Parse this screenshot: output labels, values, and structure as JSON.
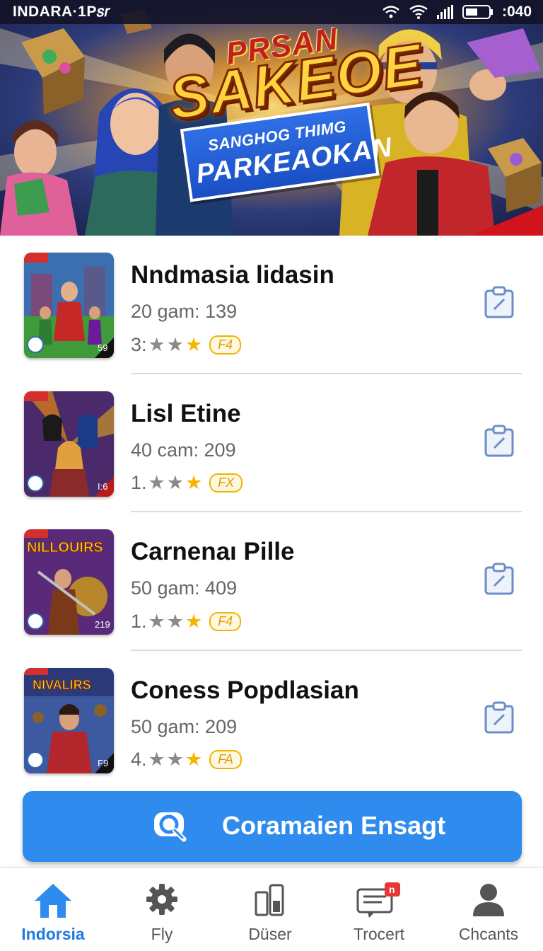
{
  "status_bar": {
    "carrier": "INDARA·1Ρ𝑠𝑟",
    "time": ":040"
  },
  "banner": {
    "title_top": "PRSAN",
    "title_main": "SAKEOE",
    "ribbon_line1": "SANGHOG THIMG",
    "ribbon_line2": "PARKEAOKAN"
  },
  "games": [
    {
      "title": "Nndmasia lidasin",
      "meta": "20 gam: 139",
      "rating_prefix": "3:",
      "tag": "F4",
      "thumb_badge": "59"
    },
    {
      "title": "Lisl Etine",
      "meta": "40 cam: 209",
      "rating_prefix": "1.",
      "tag": "FX",
      "thumb_badge": "I:6"
    },
    {
      "title": "Carnenaı Pille",
      "meta": "50 gam: 409",
      "rating_prefix": "1.",
      "tag": "F4",
      "thumb_badge": "219"
    },
    {
      "title": "Coness Popdlasian",
      "meta": "50 gam: 209",
      "rating_prefix": "4.",
      "tag": "FA",
      "thumb_badge": "F9"
    }
  ],
  "thumbs_text": [
    "NILLOUIRS",
    "NIVALIRS"
  ],
  "cta": {
    "label": "Coramaien Ensagt",
    "icon": "search-icon"
  },
  "bottom_nav": [
    {
      "label": "Indorsia",
      "icon": "home-icon",
      "active": true
    },
    {
      "label": "Fly",
      "icon": "gear-icon",
      "active": false
    },
    {
      "label": "Düser",
      "icon": "device-icon",
      "active": false
    },
    {
      "label": "Trocert",
      "icon": "message-icon",
      "active": false,
      "badge": "n"
    },
    {
      "label": "Chcants",
      "icon": "person-icon",
      "active": false
    }
  ],
  "colors": {
    "accent": "#2f8cee",
    "active_nav": "#1f7ae0",
    "star_gold": "#f5b400",
    "badge_red": "#e53935"
  }
}
